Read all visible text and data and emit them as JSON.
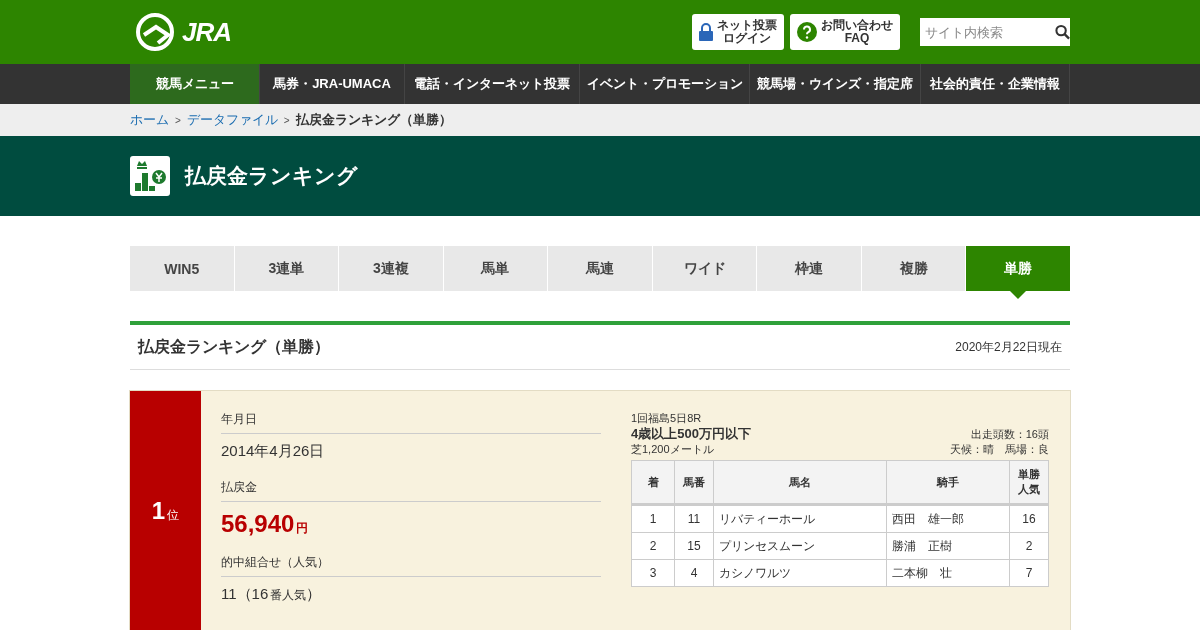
{
  "header": {
    "logo": "JRA",
    "buttons": [
      {
        "kind": "lock",
        "lines": [
          "ネット投票",
          "ログイン"
        ]
      },
      {
        "kind": "help",
        "lines": [
          "お問い合わせ",
          "FAQ"
        ]
      }
    ],
    "search": {
      "placeholder": "サイト内検索"
    }
  },
  "nav": [
    {
      "label": "競馬メニュー",
      "selected": true
    },
    {
      "label": "馬券・JRA-UMACA",
      "selected": false
    },
    {
      "label": "電話・インターネット投票",
      "selected": false
    },
    {
      "label": "イベント・プロモーション",
      "selected": false
    },
    {
      "label": "競馬場・ウインズ・指定席",
      "selected": false
    },
    {
      "label": "社会的責任・企業情報",
      "selected": false
    }
  ],
  "breadcrumb_separator": ">",
  "breadcrumb": [
    {
      "label": "ホーム",
      "link": true
    },
    {
      "label": "データファイル",
      "link": true
    },
    {
      "label": "払戻金ランキング（単勝）",
      "link": false
    }
  ],
  "page_title": "払戻金ランキング",
  "tabs": [
    {
      "label": "WIN5",
      "selected": false
    },
    {
      "label": "3連単",
      "selected": false
    },
    {
      "label": "3連複",
      "selected": false
    },
    {
      "label": "馬単",
      "selected": false
    },
    {
      "label": "馬連",
      "selected": false
    },
    {
      "label": "ワイド",
      "selected": false
    },
    {
      "label": "枠連",
      "selected": false
    },
    {
      "label": "複勝",
      "selected": false
    },
    {
      "label": "単勝",
      "selected": true
    }
  ],
  "section": {
    "title": "払戻金ランキング（単勝）",
    "date": "2020年2月22日現在"
  },
  "ranking": {
    "rank": "1",
    "rank_suffix": "位",
    "fields": [
      {
        "label": "年月日",
        "kind": "plain",
        "value": "2014年4月26日"
      },
      {
        "label": "払戻金",
        "kind": "money",
        "value": "56,940",
        "unit": "円"
      },
      {
        "label": "的中組合せ（人気）",
        "kind": "combo",
        "value": "11（16",
        "unit": "番人気",
        "tail": "）"
      }
    ],
    "race": {
      "meeting": "1回福島5日8R",
      "name": "4歳以上500万円以下",
      "course": "芝1,200メートル",
      "runners": "出走頭数：16頭",
      "conditions": "天候：晴　馬場：良",
      "columns": [
        "着",
        "馬番",
        "馬名",
        "騎手",
        "単勝人気"
      ],
      "rows": [
        [
          "1",
          "11",
          "リバティーホール",
          "西田　雄一郎",
          "16"
        ],
        [
          "2",
          "15",
          "プリンセスムーン",
          "勝浦　正樹",
          "2"
        ],
        [
          "3",
          "4",
          "カシノワルツ",
          "二本柳　壮",
          "7"
        ]
      ]
    }
  }
}
